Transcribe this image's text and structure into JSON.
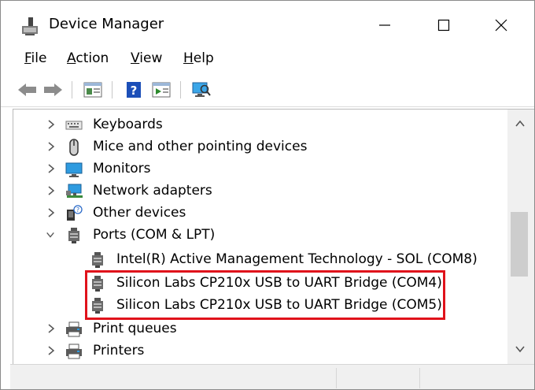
{
  "window": {
    "title": "Device Manager",
    "min_icon": "minimize-icon",
    "max_icon": "maximize-icon",
    "close_icon": "close-icon"
  },
  "menu": [
    {
      "accel": "F",
      "rest": "ile"
    },
    {
      "accel": "A",
      "rest": "ction"
    },
    {
      "accel": "V",
      "rest": "iew"
    },
    {
      "accel": "H",
      "rest": "elp"
    }
  ],
  "toolbar": [
    "back-arrow-icon",
    "forward-arrow-icon",
    "properties-icon",
    "help-icon",
    "update-driver-icon",
    "scan-hardware-icon"
  ],
  "tree": {
    "items": [
      {
        "label": "Keyboards",
        "icon": "keyboard-icon",
        "expanded": false
      },
      {
        "label": "Mice and other pointing devices",
        "icon": "mouse-icon",
        "expanded": false
      },
      {
        "label": "Monitors",
        "icon": "monitor-icon",
        "expanded": false
      },
      {
        "label": "Network adapters",
        "icon": "network-adapter-icon",
        "expanded": false
      },
      {
        "label": "Other devices",
        "icon": "other-devices-icon",
        "expanded": false
      },
      {
        "label": "Ports (COM & LPT)",
        "icon": "port-icon",
        "expanded": true
      },
      {
        "label": "Intel(R) Active Management Technology - SOL (COM8)",
        "icon": "port-icon",
        "child": true
      },
      {
        "label": "Silicon Labs CP210x USB to UART Bridge (COM4)",
        "icon": "port-icon",
        "child": true
      },
      {
        "label": "Silicon Labs CP210x USB to UART Bridge (COM5)",
        "icon": "port-icon",
        "child": true
      },
      {
        "label": "Print queues",
        "icon": "printer-icon",
        "expanded": false
      },
      {
        "label": "Printers",
        "icon": "printer-icon",
        "expanded": false
      }
    ]
  },
  "colors": {
    "highlight_border": "#e0121b",
    "accent_blue": "#1e78d6"
  }
}
